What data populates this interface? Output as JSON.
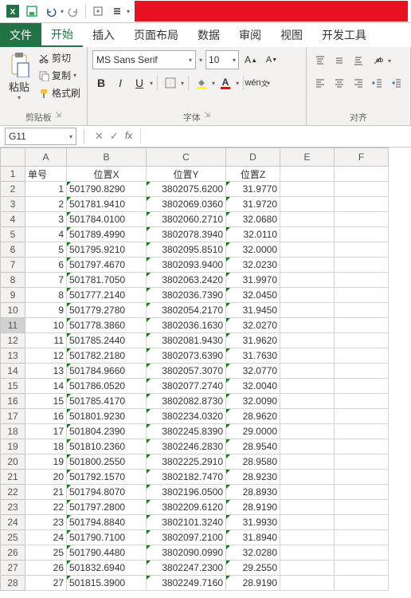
{
  "qat": {
    "save": "保存",
    "undo": "撤销",
    "redo": "重做"
  },
  "tabs": {
    "file": "文件",
    "home": "开始",
    "insert": "插入",
    "layout": "页面布局",
    "data": "数据",
    "review": "审阅",
    "view": "视图",
    "dev": "开发工具"
  },
  "clipboard": {
    "paste": "粘贴",
    "cut": "剪切",
    "copy": "复制",
    "fmt": "格式刷",
    "label": "剪贴板"
  },
  "font": {
    "name": "MS Sans Serif",
    "size": "10",
    "label": "字体",
    "bold": "B",
    "italic": "I",
    "underline": "U"
  },
  "align": {
    "label": "对齐"
  },
  "cellref": "G11",
  "columns": [
    "A",
    "B",
    "C",
    "D",
    "E",
    "F"
  ],
  "headers": {
    "A": "单号",
    "B": "位置X",
    "C": "位置Y",
    "D": "位置Z"
  },
  "rows_count": 27,
  "chart_data": {
    "type": "table",
    "columns": [
      "单号",
      "位置X",
      "位置Y",
      "位置Z"
    ],
    "data": [
      [
        1,
        "501790.8290",
        "3802075.6200",
        "31.9770"
      ],
      [
        2,
        "501781.9410",
        "3802069.0360",
        "31.9720"
      ],
      [
        3,
        "501784.0100",
        "3802060.2710",
        "32.0680"
      ],
      [
        4,
        "501789.4990",
        "3802078.3940",
        "32.0110"
      ],
      [
        5,
        "501795.9210",
        "3802095.8510",
        "32.0000"
      ],
      [
        6,
        "501797.4670",
        "3802093.9400",
        "32.0230"
      ],
      [
        7,
        "501781.7050",
        "3802063.2420",
        "31.9970"
      ],
      [
        8,
        "501777.2140",
        "3802036.7390",
        "32.0450"
      ],
      [
        9,
        "501779.2780",
        "3802054.2170",
        "31.9450"
      ],
      [
        10,
        "501778.3860",
        "3802036.1630",
        "32.0270"
      ],
      [
        11,
        "501785.2440",
        "3802081.9430",
        "31.9620"
      ],
      [
        12,
        "501782.2180",
        "3802073.6390",
        "31.7630"
      ],
      [
        13,
        "501784.9660",
        "3802057.3070",
        "32.0770"
      ],
      [
        14,
        "501786.0520",
        "3802077.2740",
        "32.0040"
      ],
      [
        15,
        "501785.4170",
        "3802082.8730",
        "32.0090"
      ],
      [
        16,
        "501801.9230",
        "3802234.0320",
        "28.9620"
      ],
      [
        17,
        "501804.2390",
        "3802245.8390",
        "29.0000"
      ],
      [
        18,
        "501810.2360",
        "3802246.2830",
        "28.9540"
      ],
      [
        19,
        "501800.2550",
        "3802225.2910",
        "28.9580"
      ],
      [
        20,
        "501792.1570",
        "3802182.7470",
        "28.9230"
      ],
      [
        21,
        "501794.8070",
        "3802196.0500",
        "28.8930"
      ],
      [
        22,
        "501797.2800",
        "3802209.6120",
        "28.9190"
      ],
      [
        23,
        "501794.8840",
        "3802101.3240",
        "31.9930"
      ],
      [
        24,
        "501790.7100",
        "3802097.2100",
        "31.8940"
      ],
      [
        25,
        "501790.4480",
        "3802090.0990",
        "32.0280"
      ],
      [
        26,
        "501832.6940",
        "3802247.2300",
        "29.2550"
      ],
      [
        27,
        "501815.3900",
        "3802249.7160",
        "28.9190"
      ]
    ]
  }
}
